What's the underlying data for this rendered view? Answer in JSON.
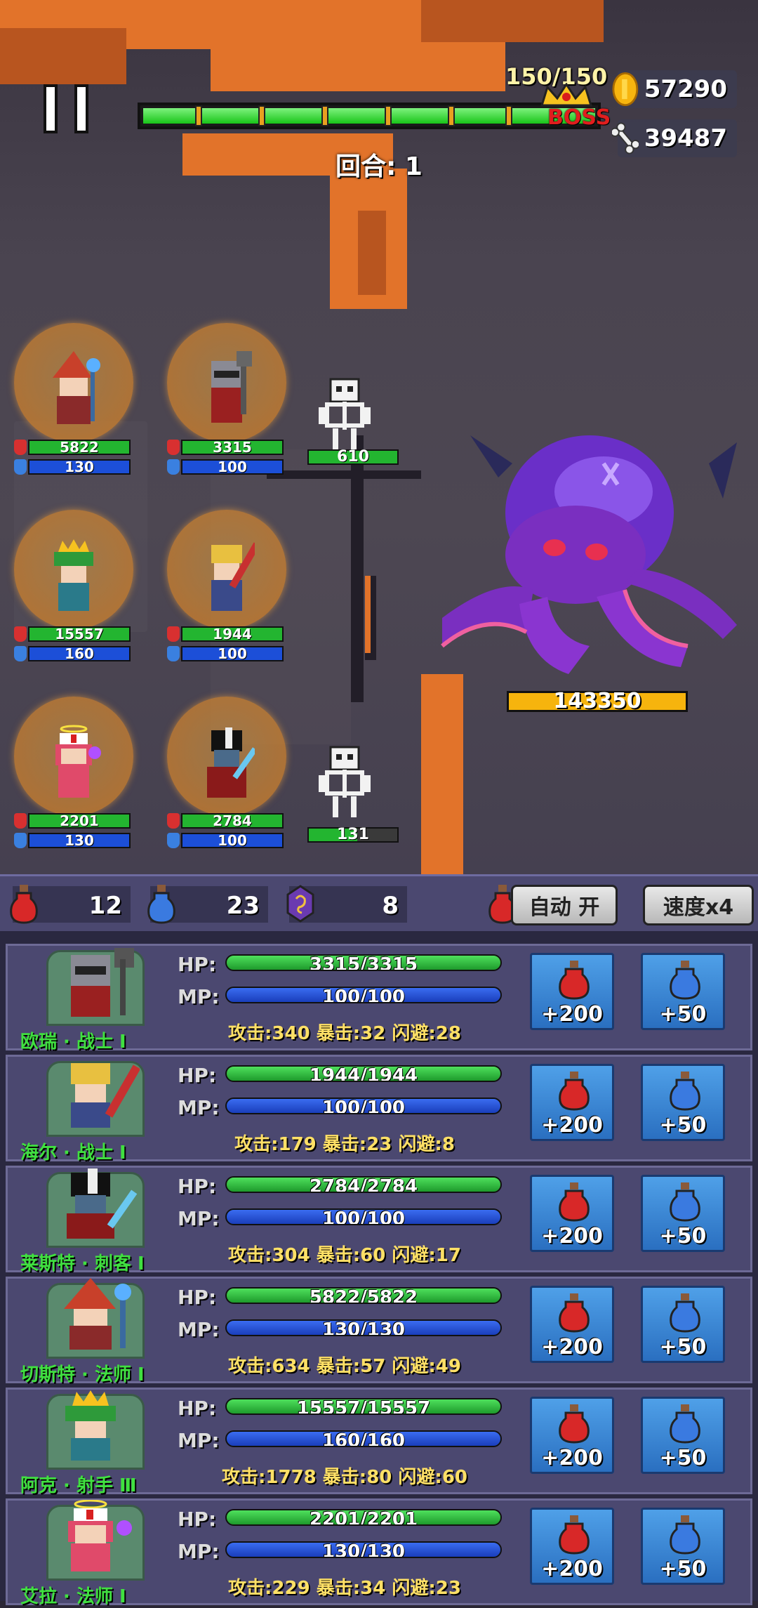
{
  "top": {
    "boss_hp_text": "150/150",
    "boss_tag": "BOSS",
    "boss_bar_fraction": 1.0,
    "gold": "57290",
    "bones": "39487",
    "round": "回合: 1"
  },
  "battlefield": {
    "heroes": [
      {
        "hp": "5822",
        "mp": "130"
      },
      {
        "hp": "3315",
        "mp": "100"
      },
      {
        "hp": "15557",
        "mp": "160"
      },
      {
        "hp": "1944",
        "mp": "100"
      },
      {
        "hp": "2201",
        "mp": "130"
      },
      {
        "hp": "2784",
        "mp": "100"
      }
    ],
    "enemies": [
      {
        "hp": "610",
        "fraction": 1.0
      },
      {
        "hp": "131",
        "fraction": 0.55
      }
    ],
    "boss_hp": "143350"
  },
  "potion_bar": {
    "hp_potions": "12",
    "mp_potions": "23",
    "special": "8",
    "auto_label": "自动 开",
    "speed_label": "速度x4"
  },
  "roster": [
    {
      "name": "欧瑞 · 战士 Ⅰ",
      "hp": "3315/3315",
      "mp": "100/100",
      "stats": "攻击:340  暴击:32  闪避:28",
      "hp_btn": "+200",
      "mp_btn": "+50",
      "icon": "warrior-knight-icon"
    },
    {
      "name": "海尔 · 战士 Ⅰ",
      "hp": "1944/1944",
      "mp": "100/100",
      "stats": "攻击:179  暴击:23  闪避:8",
      "hp_btn": "+200",
      "mp_btn": "+50",
      "icon": "warrior-blonde-icon"
    },
    {
      "name": "莱斯特 · 刺客 Ⅰ",
      "hp": "2784/2784",
      "mp": "100/100",
      "stats": "攻击:304  暴击:60  闪避:17",
      "hp_btn": "+200",
      "mp_btn": "+50",
      "icon": "assassin-icon"
    },
    {
      "name": "切斯特 · 法师 Ⅰ",
      "hp": "5822/5822",
      "mp": "130/130",
      "stats": "攻击:634  暴击:57  闪避:49",
      "hp_btn": "+200",
      "mp_btn": "+50",
      "icon": "mage-witch-icon"
    },
    {
      "name": "阿克 · 射手 Ⅲ",
      "hp": "15557/15557",
      "mp": "160/160",
      "stats": "攻击:1778  暴击:80  闪避:60",
      "hp_btn": "+200",
      "mp_btn": "+50",
      "icon": "archer-king-icon"
    },
    {
      "name": "艾拉 · 法师 Ⅰ",
      "hp": "2201/2201",
      "mp": "130/130",
      "stats": "攻击:229  暴击:34  闪避:23",
      "hp_btn": "+200",
      "mp_btn": "+50",
      "icon": "mage-nurse-icon"
    }
  ],
  "colors": {
    "hp": "#23b530",
    "mp": "#1c4fd8",
    "boss_bar": "#f6b40d",
    "lava": "#e2732a",
    "kraken": "#7a2fc0"
  }
}
